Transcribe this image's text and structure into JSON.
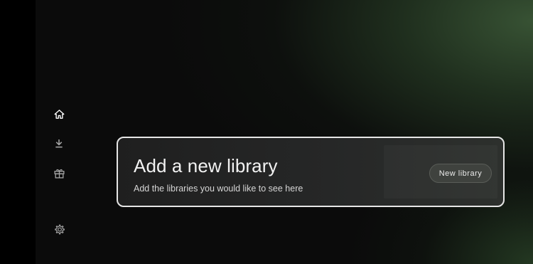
{
  "nav": {
    "items": [
      {
        "icon": "home-icon"
      },
      {
        "icon": "download-icon"
      },
      {
        "icon": "gift-icon"
      },
      {
        "icon": "settings-gear-icon"
      }
    ]
  },
  "card": {
    "title": "Add a new library",
    "subtitle": "Add the libraries you would like to see here",
    "button_label": "New library"
  },
  "colors": {
    "background": "#000000",
    "accent_green": "#3a5636",
    "card_border": "#e6e6e6",
    "button_bg": "#3f423e"
  }
}
